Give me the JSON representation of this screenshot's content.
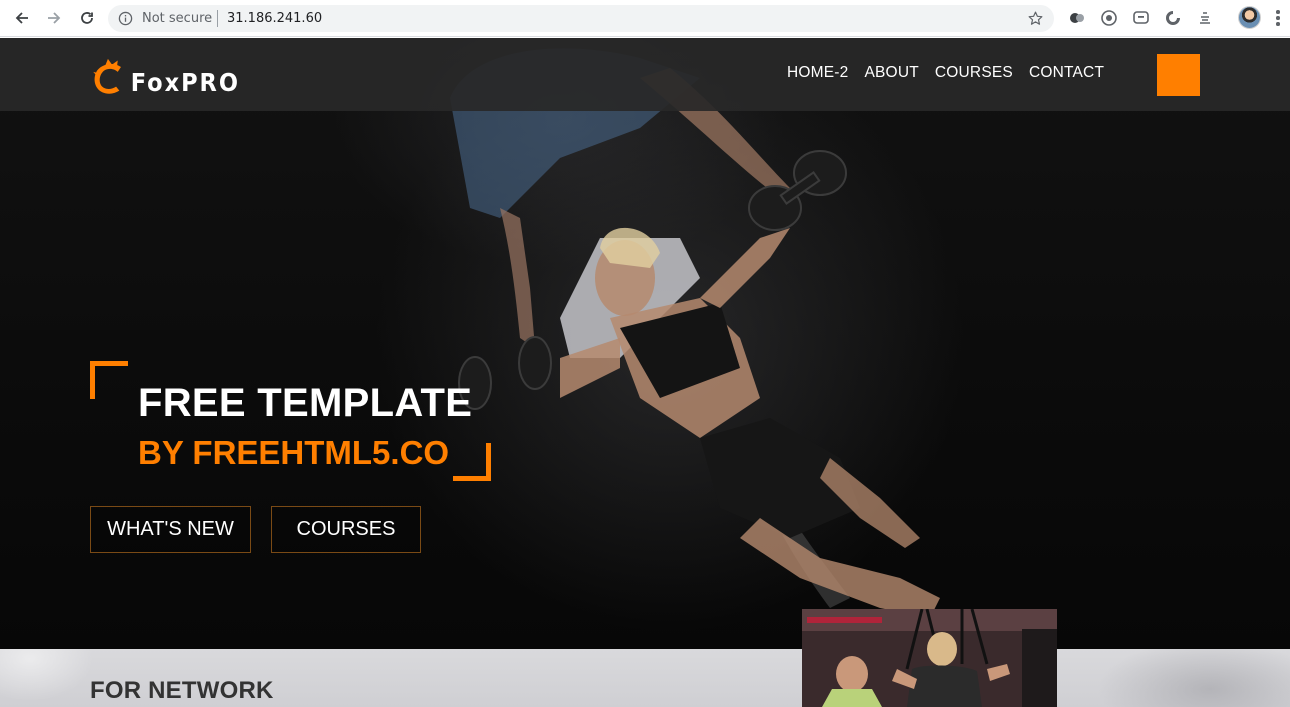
{
  "browser": {
    "security_label": "Not secure",
    "url": "31.186.241.60",
    "extensions": [
      "extension-icon-1",
      "extension-icon-2",
      "extension-icon-3",
      "extension-icon-4",
      "extension-icon-5"
    ]
  },
  "site": {
    "brand": "FoxPRO",
    "accent_color": "#ff7f00",
    "nav": [
      {
        "label": "HOME-2"
      },
      {
        "label": "ABOUT"
      },
      {
        "label": "COURSES"
      },
      {
        "label": "CONTACT"
      }
    ]
  },
  "hero": {
    "title": "FREE TEMPLATE",
    "subtitle": "BY FREEHTML5.CO",
    "buttons": [
      {
        "label": "WHAT'S NEW"
      },
      {
        "label": "COURSES"
      }
    ]
  },
  "section": {
    "heading": "FOR NETWORK"
  }
}
